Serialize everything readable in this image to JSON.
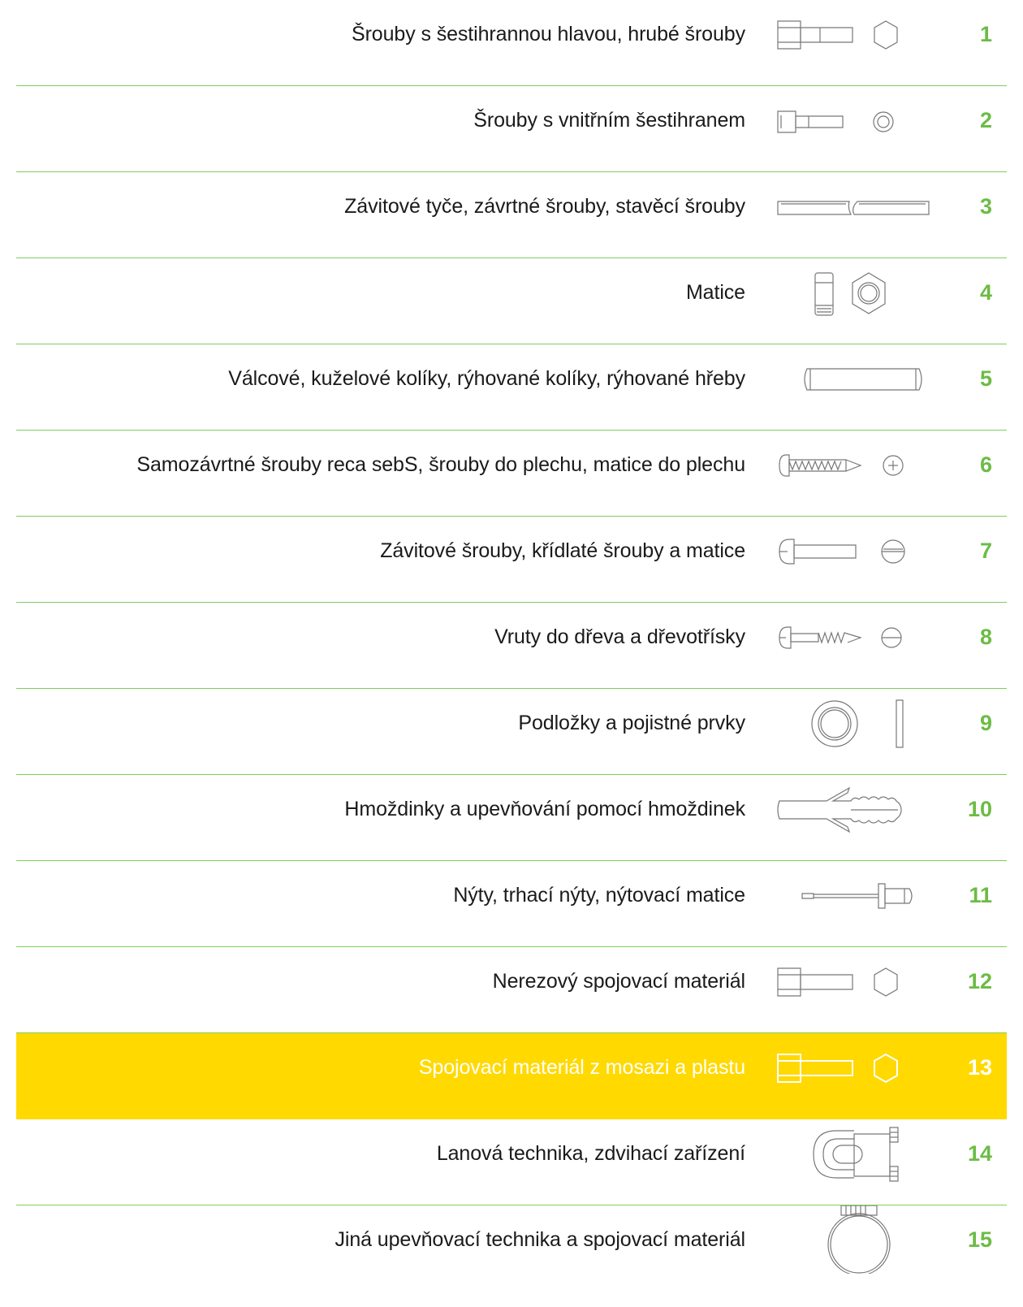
{
  "colors": {
    "accent_green": "#6cbc45",
    "separator_green": "#7fce5e",
    "highlight_yellow": "#ffd900",
    "text": "#1a1a1a"
  },
  "menu": {
    "items": [
      {
        "label": "Šrouby s šestihrannou hlavou, hrubé šrouby",
        "number": "1",
        "icon": "hex-bolt-icon"
      },
      {
        "label": "Šrouby s vnitřním šestihranem",
        "number": "2",
        "icon": "socket-cap-screw-icon"
      },
      {
        "label": "Závitové tyče, závrtné šrouby, stavěcí šrouby",
        "number": "3",
        "icon": "threaded-rod-icon"
      },
      {
        "label": "Matice",
        "number": "4",
        "icon": "hex-nut-icon"
      },
      {
        "label": "Válcové, kuželové kolíky, rýhované kolíky, rýhované hřeby",
        "number": "5",
        "icon": "dowel-pin-icon"
      },
      {
        "label": "Samozávrtné šrouby reca sebS, šrouby do plechu, matice do plechu",
        "number": "6",
        "icon": "self-tapping-screw-icon"
      },
      {
        "label": "Závitové šrouby, křídlaté šrouby a matice",
        "number": "7",
        "icon": "machine-screw-icon"
      },
      {
        "label": "Vruty do dřeva a dřevotřísky",
        "number": "8",
        "icon": "wood-screw-icon"
      },
      {
        "label": "Podložky a pojistné prvky",
        "number": "9",
        "icon": "washer-icon"
      },
      {
        "label": "Hmoždinky a upevňování pomocí hmoždinek",
        "number": "10",
        "icon": "wall-plug-icon"
      },
      {
        "label": "Nýty, trhací nýty, nýtovací matice",
        "number": "11",
        "icon": "blind-rivet-icon"
      },
      {
        "label": "Nerezový spojovací materiál",
        "number": "12",
        "icon": "stainless-bolt-icon"
      },
      {
        "label": "Spojovací materiál z mosazi a plastu",
        "number": "13",
        "icon": "brass-bolt-icon",
        "active": true
      },
      {
        "label": "Lanová technika, zdvihací zařízení",
        "number": "14",
        "icon": "wire-rope-clip-icon"
      },
      {
        "label": "Jiná upevňovací technika a spojovací materiál",
        "number": "15",
        "icon": "hose-clamp-icon"
      }
    ]
  }
}
